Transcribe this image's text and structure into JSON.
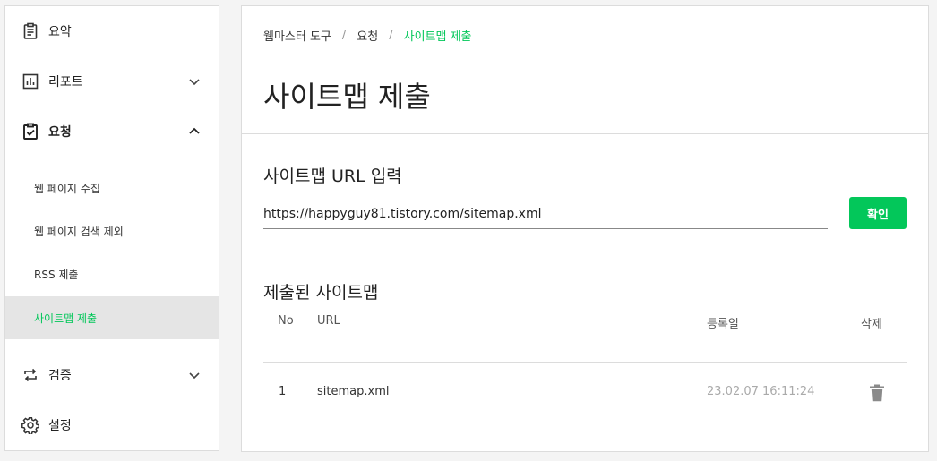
{
  "sidebar": {
    "items": [
      {
        "label": "요약"
      },
      {
        "label": "리포트"
      },
      {
        "label": "요청"
      },
      {
        "label": "검증"
      },
      {
        "label": "설정"
      }
    ],
    "sub_items": [
      {
        "label": "웹 페이지 수집"
      },
      {
        "label": "웹 페이지 검색 제외"
      },
      {
        "label": "RSS 제출"
      },
      {
        "label": "사이트맵 제출"
      }
    ]
  },
  "breadcrumb": {
    "items": [
      "웹마스터 도구",
      "요청",
      "사이트맵 제출"
    ],
    "separator": "/"
  },
  "page_title": "사이트맵 제출",
  "sitemap_input": {
    "label": "사이트맵 URL 입력",
    "value": "https://happyguy81.tistory.com/sitemap.xml"
  },
  "confirm_label": "확인",
  "submitted": {
    "title": "제출된 사이트맵",
    "columns": {
      "no": "No",
      "url": "URL",
      "date": "등록일",
      "delete": "삭제"
    },
    "rows": [
      {
        "no": "1",
        "url": "sitemap.xml",
        "date": "23.02.07 16:11:24"
      }
    ]
  },
  "colors": {
    "accent": "#03c75a"
  }
}
